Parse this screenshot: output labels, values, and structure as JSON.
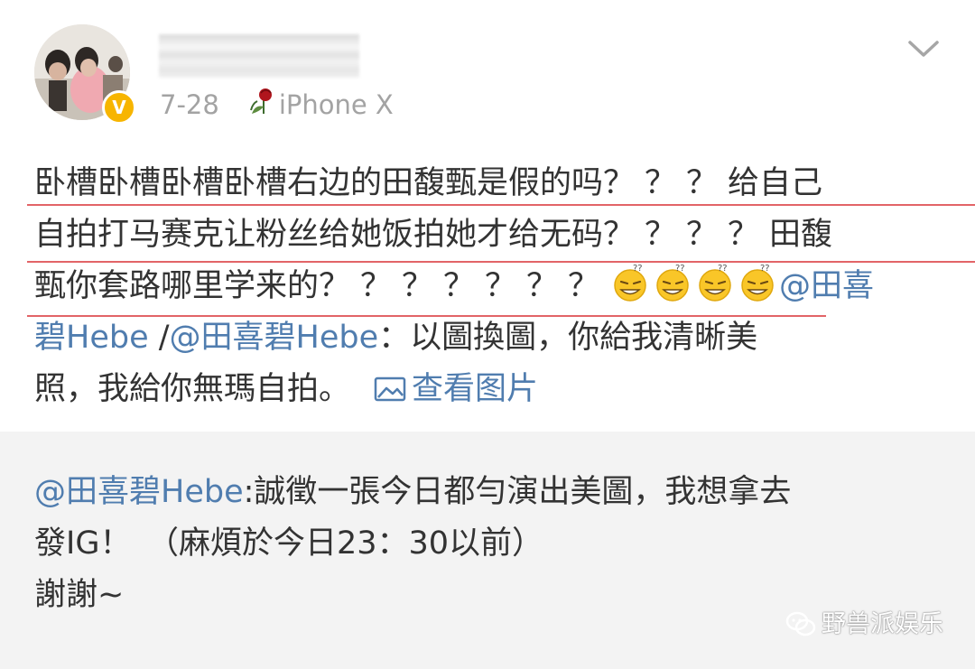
{
  "header": {
    "date": "7-28",
    "device": "iPhone X",
    "verified_mark": "V",
    "menu_icon": "chevron-down-icon"
  },
  "post": {
    "line1_text": "卧槽卧槽卧槽卧槽右边的田馥甄是假的吗",
    "line1_q": "？？？",
    "line1_tail": "给自己",
    "line2_text": "自拍打马赛克让粉丝给她饭拍她才给无码",
    "line2_q": "？？？？",
    "line2_tail": "田馥",
    "line3_text": "甄你套路哪里学来的",
    "line3_q": "？？？？？？？",
    "line3_mention": "@田喜",
    "line4_mention1": "碧Hebe",
    "line4_sep": " /",
    "line4_mention2": "@田喜碧Hebe",
    "line4_text": "：以圖換圖，你給我清晰美",
    "line5_text": "照，我給你無瑪自拍。",
    "view_image": "查看图片",
    "emoji_icon": "sweat-smile-emoji-icon",
    "emoji_count": 4
  },
  "repost": {
    "mention": "@田喜碧Hebe",
    "line1_text": ":誠徵一張今日都勻演出美圖，我想拿去",
    "line2": "發IG！　（麻煩於今日23：30以前）",
    "line3": "謝謝~"
  },
  "watermark": {
    "text": "野兽派娱乐",
    "icon": "wechat-icon"
  },
  "colors": {
    "link": "#507daf",
    "text": "#333333",
    "meta": "#a3a3a3",
    "repost_bg": "#f3f3f3",
    "verified": "#f7b500",
    "annotation_line": "#e26467"
  }
}
